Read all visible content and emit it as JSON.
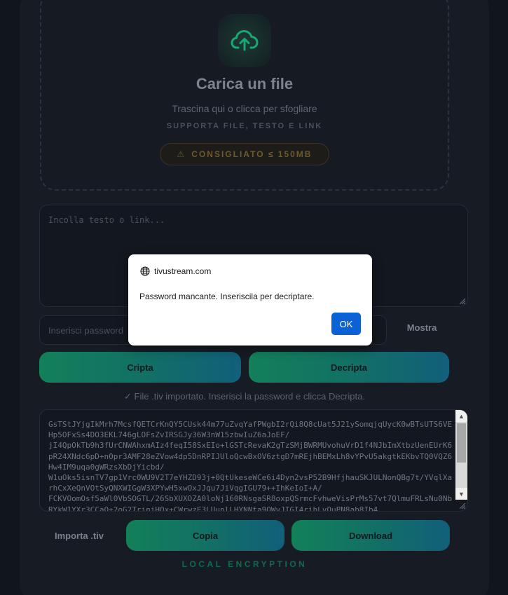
{
  "dropzone": {
    "title": "Carica un file",
    "subtitle": "Trascina qui o clicca per sfogliare",
    "support": "SUPPORTA FILE, TESTO E LINK",
    "recommend_icon": "⚠",
    "recommend": "CONSIGLIATO ≤ 150MB"
  },
  "input": {
    "text_placeholder": "Incolla testo o link...",
    "password_placeholder": "Inserisci password",
    "show_label": "Mostra"
  },
  "actions": {
    "encrypt_label": "Cripta",
    "decrypt_label": "Decripta",
    "import_label": "Importa .tiv",
    "copy_label": "Copia",
    "download_label": "Download"
  },
  "status": "✓ File .tiv importato. Inserisci la password e clicca Decripta.",
  "output": "GsTStJYjgIkMrh7McsfQETCrKnQY5CUsk44m77uZvqYafPWgbI2rQi8Q8cUat5J21ySomqjqUycK0wBTsUTS6VEHp5OFxSs4DO3EKL746gLOFsZvIRSGJy36W3nW15zbwIuZ6aJoEF/\njI4QpOkTb9h3fUrCNWAhxmAIz4feqI58SxEIo+lGSTcRevaK2gTzSMjBWRMUvohuVrD1f4NJbImXtbzUenEUrK6pR24XNdc6pD+n0pr3AMF28eZVow4dp5DnRPIJUloQcwBxOV6ztgD7mREjhBEMxLh8vYPvU5akgtkEKbvTQ0VQZ6Hw4IM9uqa0gWRzsXbDjYicbd/\nW1uOks5isnTV7gp1Vrc0WU9V2T7eYHZD93j+0QtUkeseWCe6i4Dyn2vsP52B9HfjhauSKJULNonQBg7t/YVqlXarhCxXeQnVOtSyQNXWIGgW3XPYwH5xwOxJJqu7JiVqgIGU79++IhKeIoI+A/\nFCKVOomOsf5aWl0VbSOGTL/26SbXUXOZA0loNj160RNsgaSR8oxpQSrmcFvhweVisPrMs57vt7QlmuFRLsNu0NbRYkW1YXr3CCaO+2oG2TriniHOx+CWrwzE3LUuplLHYNNta9OWvJIGI4rihLvOuPN8ab8Ib4",
  "footer": "LOCAL ENCRYPTION",
  "dialog": {
    "host": "tivustream.com",
    "message": "Password mancante. Inseriscila per decriptare.",
    "ok_label": "OK"
  },
  "colors": {
    "accent_green": "#13805a",
    "accent_blue": "#125f7a",
    "dialog_button": "#0b62d6"
  }
}
